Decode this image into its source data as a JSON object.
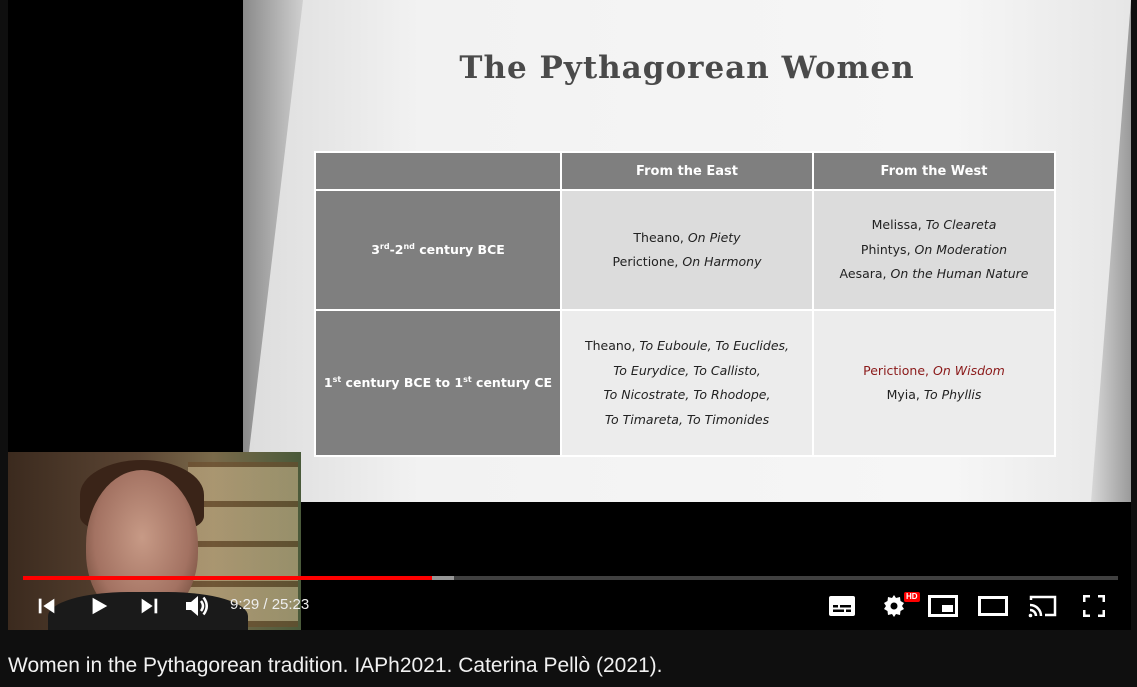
{
  "slide": {
    "title": "The Pythagorean Women",
    "headers": [
      "",
      "From the East",
      "From the West"
    ],
    "rows": [
      {
        "label_pre": "3",
        "label_sup1": "rd",
        "label_mid": "-2",
        "label_sup2": "nd",
        "label_post": " century BCE",
        "east": [
          {
            "name": "Theano, ",
            "work": "On Piety"
          },
          {
            "name": "Perictione, ",
            "work": "On Harmony"
          }
        ],
        "west": [
          {
            "name": "Melissa, ",
            "work": "To Cleareta"
          },
          {
            "name": "Phintys, ",
            "work": "On Moderation"
          },
          {
            "name": "Aesara, ",
            "work": "On the Human Nature"
          }
        ]
      },
      {
        "label_pre": "1",
        "label_sup1": "st",
        "label_mid": " century BCE to 1",
        "label_sup2": "st",
        "label_post": " century CE",
        "east": [
          {
            "name": "Theano, ",
            "work": "To Euboule, To Euclides,"
          },
          {
            "name": "",
            "work": "To Eurydice, To Callisto,"
          },
          {
            "name": "",
            "work": "To Nicostrate, To Rhodope,"
          },
          {
            "name": "",
            "work": "To Timareta, To Timonides"
          }
        ],
        "west": [
          {
            "name": "Perictione, ",
            "work": "On Wisdom",
            "highlight": true
          },
          {
            "name": "Myia, ",
            "work": "To Phyllis"
          }
        ]
      }
    ],
    "highlight_color": "#8b1a1a"
  },
  "player": {
    "current_time": "9:29",
    "duration": "25:23",
    "time_display": "9:29 / 25:23",
    "played_fraction": 0.3737,
    "buffered_fraction": 0.394,
    "progress_color": "#ff0000",
    "hd_badge": "HD",
    "buttons": [
      "previous-icon",
      "play-icon",
      "next-icon",
      "volume-icon",
      "subtitles-icon",
      "settings-icon",
      "miniplayer-icon",
      "theater-mode-icon",
      "cast-icon",
      "fullscreen-icon"
    ]
  },
  "video": {
    "title": "Women in the Pythagorean tradition. IAPh2021. Caterina Pellò (2021)."
  }
}
